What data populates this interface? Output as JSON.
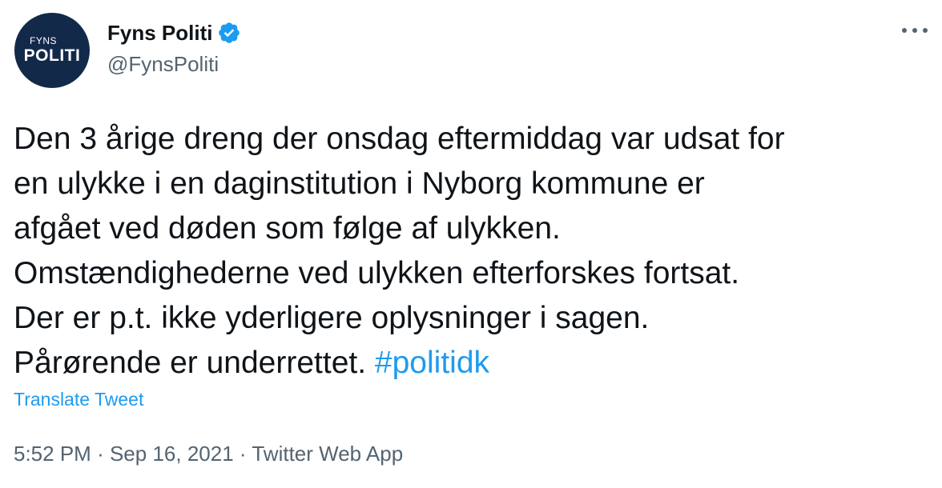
{
  "author": {
    "avatar": {
      "small_text": "FYNS",
      "big_text": "POLITI",
      "bg_color": "#12294a"
    },
    "display_name": "Fyns Politi",
    "verified_icon": "verified-badge-icon",
    "handle": "@FynsPoliti"
  },
  "more_icon": "more-options-icon",
  "tweet": {
    "text_lines": [
      "Den 3 årige dreng der onsdag eftermiddag var udsat for",
      "en ulykke i en daginstitution i Nyborg kommune er",
      "afgået ved døden som følge af ulykken.",
      "Omstændighederne ved ulykken efterforskes fortsat.",
      "Der er p.t. ikke yderligere oplysninger i sagen.",
      "Pårørende er underrettet."
    ],
    "hashtag": "#politidk"
  },
  "translate_label": "Translate Tweet",
  "meta": {
    "time": "5:52 PM",
    "separator": "·",
    "date": "Sep 16, 2021",
    "source": "Twitter Web App"
  },
  "colors": {
    "accent": "#1d9bf0",
    "text": "#0f1419",
    "secondary": "#536471"
  }
}
